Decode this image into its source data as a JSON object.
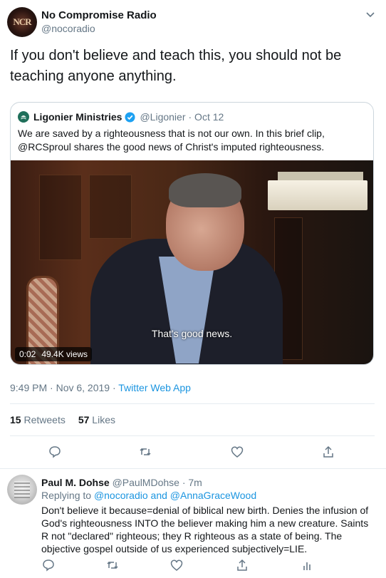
{
  "tweet": {
    "avatar_text": "NCR",
    "name": "No Compromise Radio",
    "handle": "@nocoradio",
    "text": "If you don't believe and teach this, you should not be teaching anyone anything.",
    "timestamp": "9:49 PM · Nov 6, 2019 · ",
    "source": "Twitter Web App",
    "retweets_count": "15",
    "retweets_label": "Retweets",
    "likes_count": "57",
    "likes_label": "Likes"
  },
  "quoted": {
    "name": "Ligonier Ministries",
    "handle": "@Ligonier",
    "date": "· Oct 12",
    "text": "We are saved by a righteousness that is not our own. In this brief clip, @RCSproul shares the good news of Christ's imputed righteousness.",
    "video": {
      "subtitle": "That's good news.",
      "duration": "0:02",
      "views": "49.4K views"
    }
  },
  "reply": {
    "name": "Paul M. Dohse",
    "handle": "@PaulMDohse",
    "time": "· 7m",
    "replying_prefix": "Replying to ",
    "replying_to": "@nocoradio and @AnnaGraceWood",
    "text": "Don't believe it because=denial of biblical new birth. Denies the infusion of God's righteousness INTO the believer making him a new creature. Saints R not \"declared\" righteous; they R righteous as a state of being. The objective gospel outside of us experienced subjectively=LIE."
  },
  "colors": {
    "text": "#14171a",
    "secondary": "#657786",
    "link": "#1b95e0",
    "border": "#e6ecf0",
    "verified": "#1da1f2"
  },
  "icons": [
    "chevron-down-icon",
    "ligonier-logo-icon",
    "verified-icon",
    "reply-icon",
    "retweet-icon",
    "like-icon",
    "share-icon",
    "analytics-icon"
  ]
}
